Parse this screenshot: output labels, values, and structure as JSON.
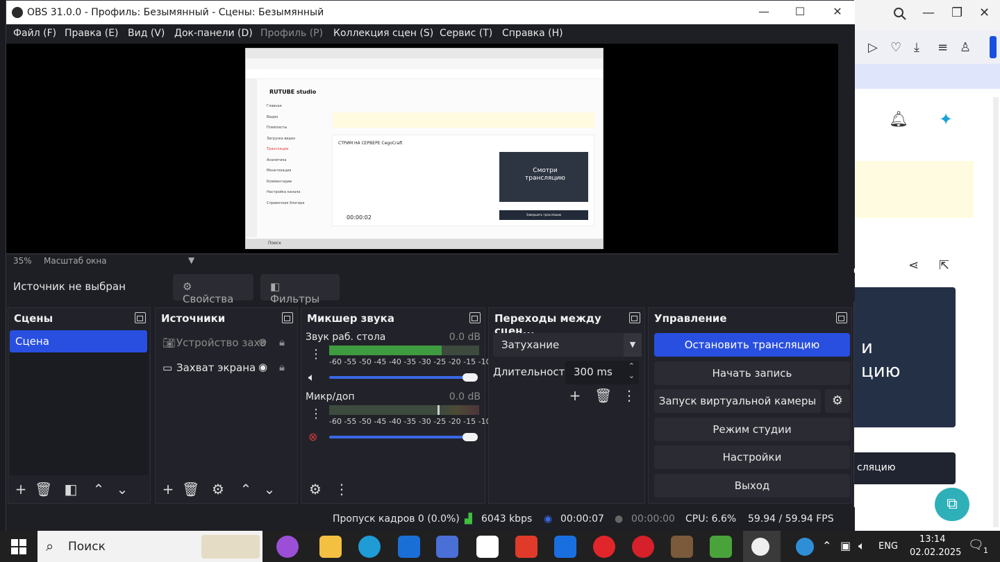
{
  "obs": {
    "title": "OBS 31.0.0 - Профиль: Безымянный - Сцены: Безымянный",
    "menu": [
      {
        "label": "Файл (F)",
        "disabled": false
      },
      {
        "label": "Правка (E)",
        "disabled": false
      },
      {
        "label": "Вид (V)",
        "disabled": false
      },
      {
        "label": "Док-панели (D)",
        "disabled": false
      },
      {
        "label": "Профиль (P)",
        "disabled": true
      },
      {
        "label": "Коллекция сцен (S)",
        "disabled": false
      },
      {
        "label": "Сервис (T)",
        "disabled": false
      },
      {
        "label": "Справка (H)",
        "disabled": false
      }
    ],
    "zoom": {
      "percent": "35%",
      "mode": "Масштаб окна"
    },
    "source_bar": {
      "status": "Источник не выбран",
      "properties": "Свойства",
      "filters": "Фильтры"
    },
    "scenes": {
      "title": "Сцены",
      "items": [
        "Сцена"
      ]
    },
    "sources": {
      "title": "Источники",
      "items": [
        {
          "label": "Устройство захв",
          "icon": "camera-icon",
          "visible": false
        },
        {
          "label": "Захват экрана",
          "icon": "monitor-icon",
          "visible": true
        }
      ]
    },
    "mixer": {
      "title": "Микшер звука",
      "channels": [
        {
          "name": "Звук раб. стола",
          "db": "0.0 dB",
          "level": 0.75
        },
        {
          "name": "Микр/доп",
          "db": "0.0 dB",
          "level": 0.0
        }
      ],
      "scale": "-60 -55 -50 -45 -40 -35 -30 -25 -20 -15 -10 -5  0"
    },
    "transitions": {
      "title": "Переходы между сцен...",
      "selected": "Затухание",
      "duration_label": "Длительность",
      "duration_value": "300 ms"
    },
    "controls": {
      "title": "Управление",
      "stop_stream": "Остановить трансляцию",
      "start_record": "Начать запись",
      "virtual_cam": "Запуск виртуальной камеры",
      "studio_mode": "Режим студии",
      "settings": "Настройки",
      "exit": "Выход"
    },
    "status": {
      "dropped": "Пропуск кадров 0 (0.0%)",
      "bitrate": "6043 kbps",
      "stream_time": "00:00:07",
      "record_time": "00:00:00",
      "cpu": "CPU: 6.6%",
      "fps": "59.94 / 59.94 FPS"
    }
  },
  "preview": {
    "brand": "RUTUBE studio",
    "nav": [
      "Главная",
      "Видео",
      "Плейлисты",
      "Загрузка видео",
      "Трансляции",
      "Аналитика",
      "Монетизация",
      "Комментарии",
      "Настройка канала",
      "Справочник блогера"
    ],
    "stream_title": "СТРИМ НА СЕРВЕРЕ CegoCraft",
    "thumb_text": "Смотри трансляцию",
    "time": "00:00:02",
    "end_button": "Завершить трансляцию",
    "search": "Поиск"
  },
  "browser": {
    "card_text": "и\nцию",
    "button_text": "сляцию"
  },
  "taskbar": {
    "search": "Поиск",
    "lang": "ENG",
    "time": "13:14",
    "date": "02.02.2025",
    "notifications": "1"
  }
}
